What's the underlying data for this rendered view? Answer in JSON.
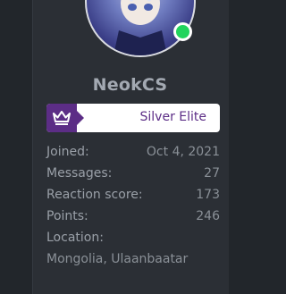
{
  "profile": {
    "username": "NeokCS",
    "online": true,
    "online_color": "#21d45c",
    "rank": {
      "label": "Silver Elite",
      "icon": "crown-icon",
      "color": "#5c2d86"
    }
  },
  "stats": {
    "joined_label": "Joined:",
    "joined_value": "Oct 4, 2021",
    "messages_label": "Messages:",
    "messages_value": "27",
    "reaction_label": "Reaction score:",
    "reaction_value": "173",
    "points_label": "Points:",
    "points_value": "246",
    "location_label": "Location:",
    "location_value": "Mongolia, Ulaanbaatar"
  }
}
